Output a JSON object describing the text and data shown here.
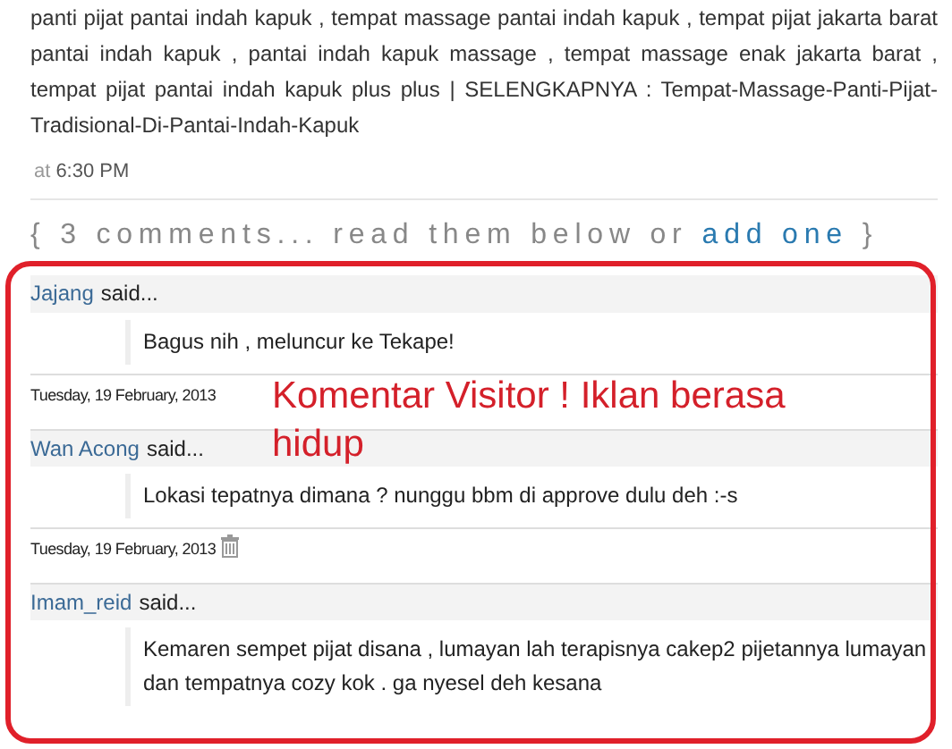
{
  "post": {
    "body": "panti pijat pantai indah kapuk , tempat massage pantai indah kapuk , tempat pijat jakarta barat pantai indah kapuk , pantai indah kapuk massage , tempat massage enak jakarta barat , tempat pijat pantai indah kapuk plus plus | SELENGKAPNYA : Tempat-Massage-Panti-Pijat-Tradisional-Di-Pantai-Indah-Kapuk",
    "time_prefix": "at",
    "time": "6:30 PM"
  },
  "comments_header": {
    "text": "{ 3 comments... read them below or",
    "link": "add one",
    "close": "}"
  },
  "comments": [
    {
      "author": "Jajang",
      "said": "said...",
      "text": "Bagus nih , meluncur ke Tekape!",
      "date": "Tuesday, 19 February, 2013",
      "delete_icon": false
    },
    {
      "author": "Wan Acong",
      "said": "said...",
      "text": "Lokasi tepatnya dimana ? nunggu bbm di approve dulu deh :-s",
      "date": "Tuesday, 19 February, 2013",
      "delete_icon": true
    },
    {
      "author": "Imam_reid",
      "said": "said...",
      "text": "Kemaren sempet pijat disana , lumayan lah terapisnya cakep2 pijetannya lumayan dan tempatnya cozy kok . ga nyesel deh kesana"
    }
  ],
  "annotation": {
    "text": "Komentar Visitor ! Iklan berasa hidup"
  }
}
